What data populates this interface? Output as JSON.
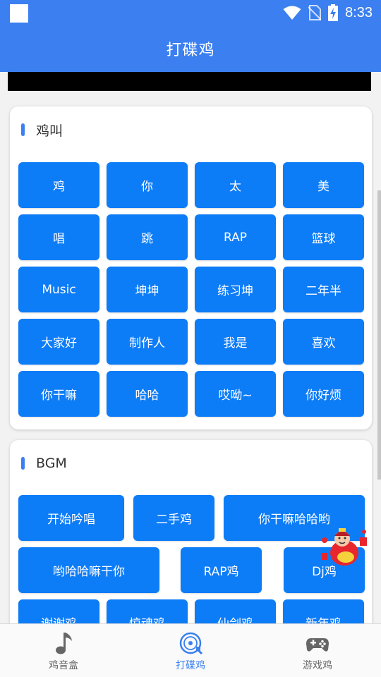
{
  "status": {
    "time": "8:33"
  },
  "app": {
    "title": "打碟鸡"
  },
  "section1": {
    "title": "鸡叫",
    "buttons": [
      "鸡",
      "你",
      "太",
      "美",
      "唱",
      "跳",
      "RAP",
      "篮球",
      "Music",
      "坤坤",
      "练习坤",
      "二年半",
      "大家好",
      "制作人",
      "我是",
      "喜欢",
      "你干嘛",
      "哈哈",
      "哎呦~",
      "你好烦"
    ]
  },
  "section2": {
    "title": "BGM",
    "buttons": [
      "开始吟唱",
      "二手鸡",
      "你干嘛哈哈哟",
      "哟哈哈嘛干你",
      "RAP鸡",
      "Dj鸡",
      "谢谢鸡",
      "惊魂鸡",
      "仙剑鸡",
      "新年鸡"
    ]
  },
  "nav": {
    "items": [
      {
        "label": "鸡音盒",
        "icon": "music-note-icon"
      },
      {
        "label": "打碟鸡",
        "icon": "disc-icon"
      },
      {
        "label": "游戏鸡",
        "icon": "gamepad-icon"
      }
    ],
    "active_index": 1
  },
  "colors": {
    "primary": "#3b7ff0",
    "button": "#0d7cf7"
  }
}
